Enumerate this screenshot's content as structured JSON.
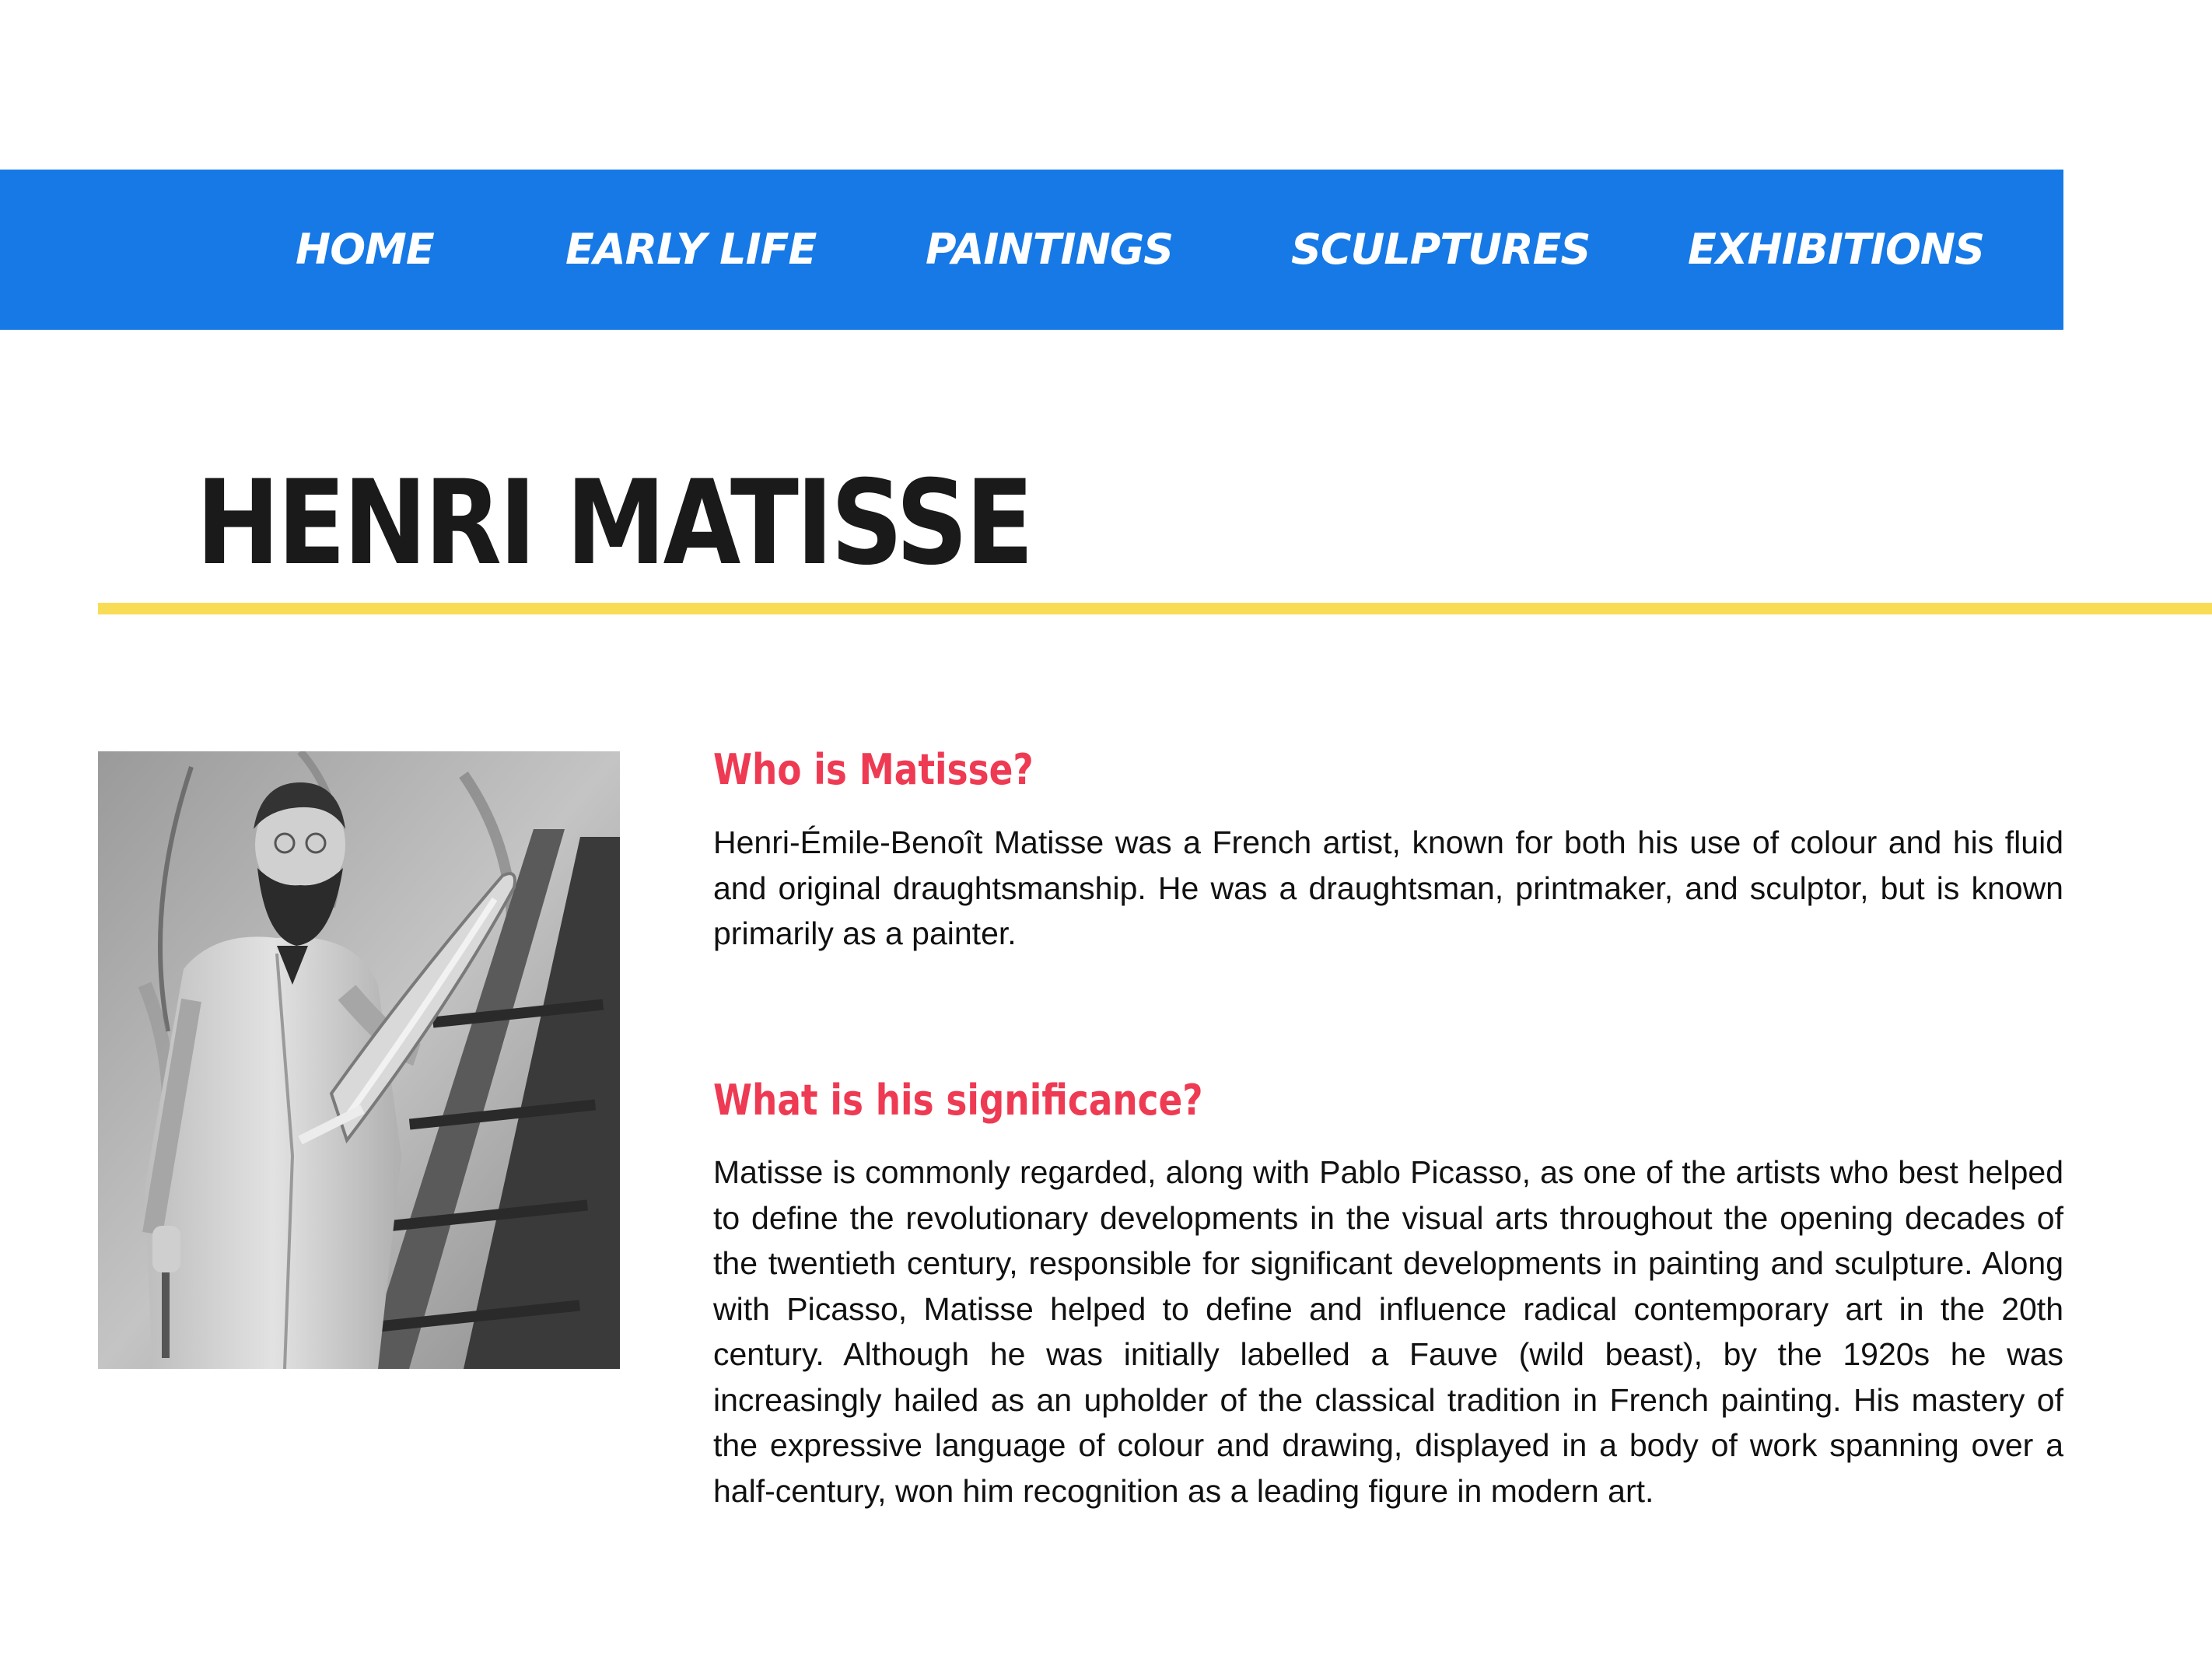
{
  "nav": {
    "items": [
      {
        "label": "HOME"
      },
      {
        "label": "EARLY LIFE"
      },
      {
        "label": "PAINTINGS"
      },
      {
        "label": "SCULPTURES"
      },
      {
        "label": "EXHIBITIONS"
      }
    ]
  },
  "page": {
    "title": "HENRI MATISSE"
  },
  "portrait": {
    "description_icon": "portrait-photo"
  },
  "sections": [
    {
      "heading": "Who is Matisse?",
      "body": "Henri-Émile-Benoît Matisse was a French artist, known for both his use of colour and his fluid and original draughtsmanship. He was a draughtsman, printmaker, and sculptor, but is known primarily as a painter."
    },
    {
      "heading": "What is his significance?",
      "body": "Matisse is commonly regarded, along with Pablo Picasso, as one of the artists who best helped to define the revolutionary developments in the visual arts throughout the opening decades of the twentieth century, responsible for significant developments in painting and sculpture. Along with Picasso, Matisse helped to define and influence radical contemporary art in the 20th century. Although he was initially labelled a Fauve (wild beast), by the 1920s he was increasingly hailed as an upholder of the classical tradition in French painting. His mastery of the expressive language of colour and drawing, displayed in a body of work spanning over a half-century, won him recognition as a leading figure in modern art."
    }
  ],
  "colors": {
    "nav_background": "#1779e6",
    "nav_text": "#ffffff",
    "title_rule": "#f8dc56",
    "heading_accent": "#ee3a52",
    "body_text": "#111111"
  }
}
